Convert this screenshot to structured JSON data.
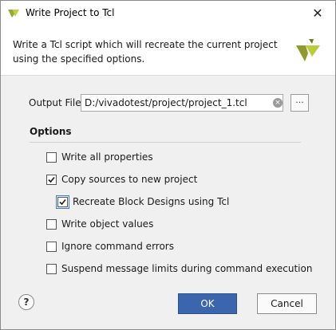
{
  "window": {
    "title": "Write Project to Tcl",
    "close_glyph": "✕"
  },
  "header": {
    "description": "Write a Tcl script which will recreate the current project using the specified options.",
    "logo_icon": "vivado-logo-icon"
  },
  "output_file": {
    "label": "Output File",
    "value": "D:/vivadotest/project/project_1.tcl",
    "clear_glyph": "×",
    "browse_label": "..."
  },
  "options": {
    "title": "Options",
    "items": [
      {
        "label": "Write all properties",
        "checked": false
      },
      {
        "label": "Copy sources to new project",
        "checked": true
      },
      {
        "label": "Recreate Block Designs using Tcl",
        "checked": true
      },
      {
        "label": "Write object values",
        "checked": false
      },
      {
        "label": "Ignore command errors",
        "checked": false
      },
      {
        "label": "Suspend message limits during command execution",
        "checked": false
      }
    ]
  },
  "footer": {
    "help_label": "?",
    "ok_label": "OK",
    "cancel_label": "Cancel"
  },
  "colors": {
    "ok_button": "#3b65ad",
    "check_color": "#1a1a1a"
  }
}
